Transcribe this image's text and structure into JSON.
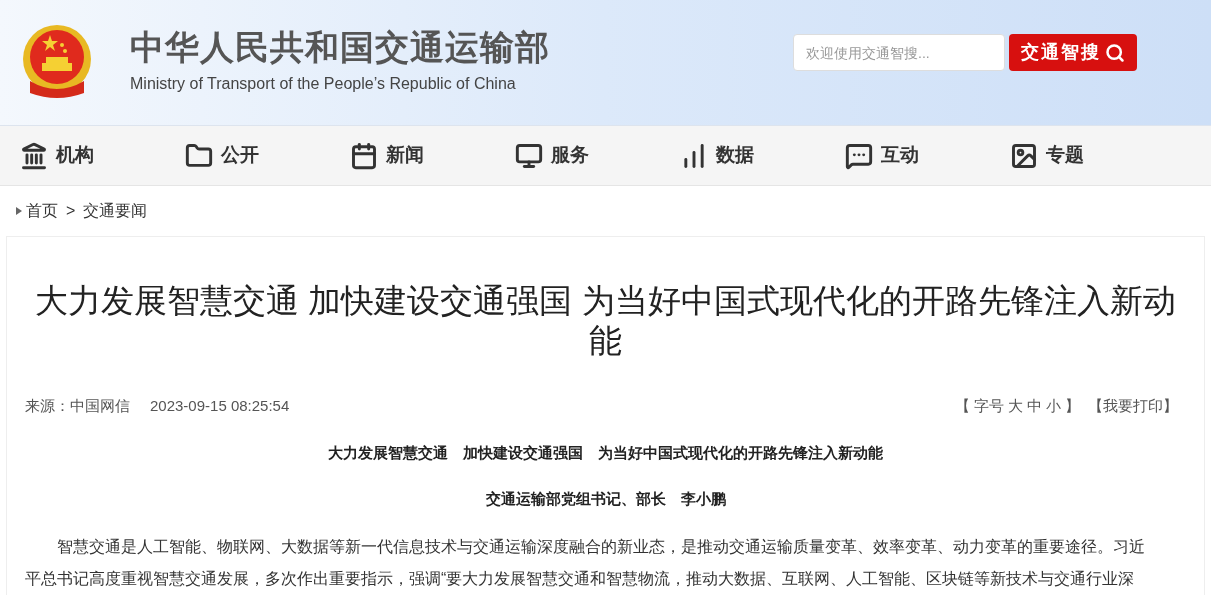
{
  "header": {
    "title": "中华人民共和国交通运输部",
    "subtitle": "Ministry of Transport of the People’s Republic of China",
    "search": {
      "placeholder": "欢迎使用交通智搜...",
      "button": "交通智搜"
    }
  },
  "nav": [
    {
      "label": "机构"
    },
    {
      "label": "公开"
    },
    {
      "label": "新闻"
    },
    {
      "label": "服务"
    },
    {
      "label": "数据"
    },
    {
      "label": "互动"
    },
    {
      "label": "专题"
    }
  ],
  "breadcrumb": {
    "items": [
      "首页",
      "交通要闻"
    ],
    "separator": ">"
  },
  "article": {
    "title": "大力发展智慧交通 加快建设交通强国 为当好中国式现代化的开路先锋注入新动能",
    "source": "来源：中国网信",
    "date": "2023-09-15 08:25:54",
    "tools": {
      "open": "【",
      "label": "字号",
      "sizes": [
        "大",
        "中",
        "小"
      ],
      "close": "】",
      "print": "【我要打印】"
    },
    "headline": "大力发展智慧交通　加快建设交通强国　为当好中国式现代化的开路先锋注入新动能",
    "byline": "交通运输部党组书记、部长　李小鹏",
    "paragraph_lines": [
      "智慧交通是人工智能、物联网、大数据等新一代信息技术与交通运输深度融合的新业态，是推动交通运输质量变革、效率变革、动力变革的重要途径。习近",
      "平总书记高度重视智慧交通发展，多次作出重要指示，强调“要大力发展智慧交通和智慧物流，推动大数据、互联网、人工智能、区块链等新技术与交通行业深"
    ]
  }
}
